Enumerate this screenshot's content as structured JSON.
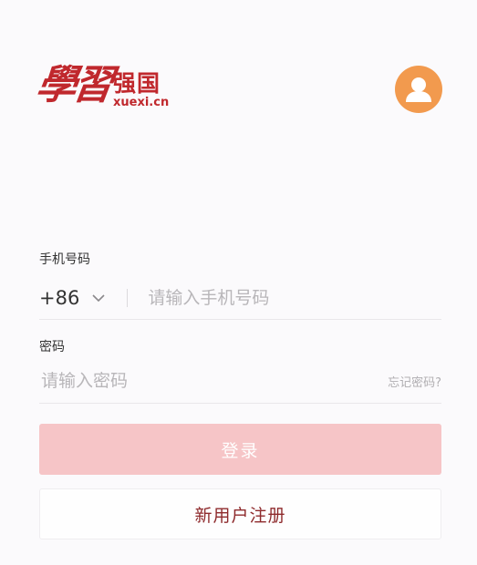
{
  "logo": {
    "script_text": "學習",
    "chinese_text": "强国",
    "domain_text": "xuexi.cn"
  },
  "avatar": {
    "icon": "user-icon"
  },
  "phone": {
    "label": "手机号码",
    "country_code": "+86",
    "placeholder": "请输入手机号码"
  },
  "password": {
    "label": "密码",
    "placeholder": "请输入密码",
    "forgot_link": "忘记密码?"
  },
  "buttons": {
    "login": "登录",
    "register": "新用户注册"
  },
  "colors": {
    "brand": "#c0282d",
    "avatar_bg": "#f29a4e",
    "login_bg_disabled": "#f6c5c7",
    "register_text": "#8e2a2c"
  }
}
